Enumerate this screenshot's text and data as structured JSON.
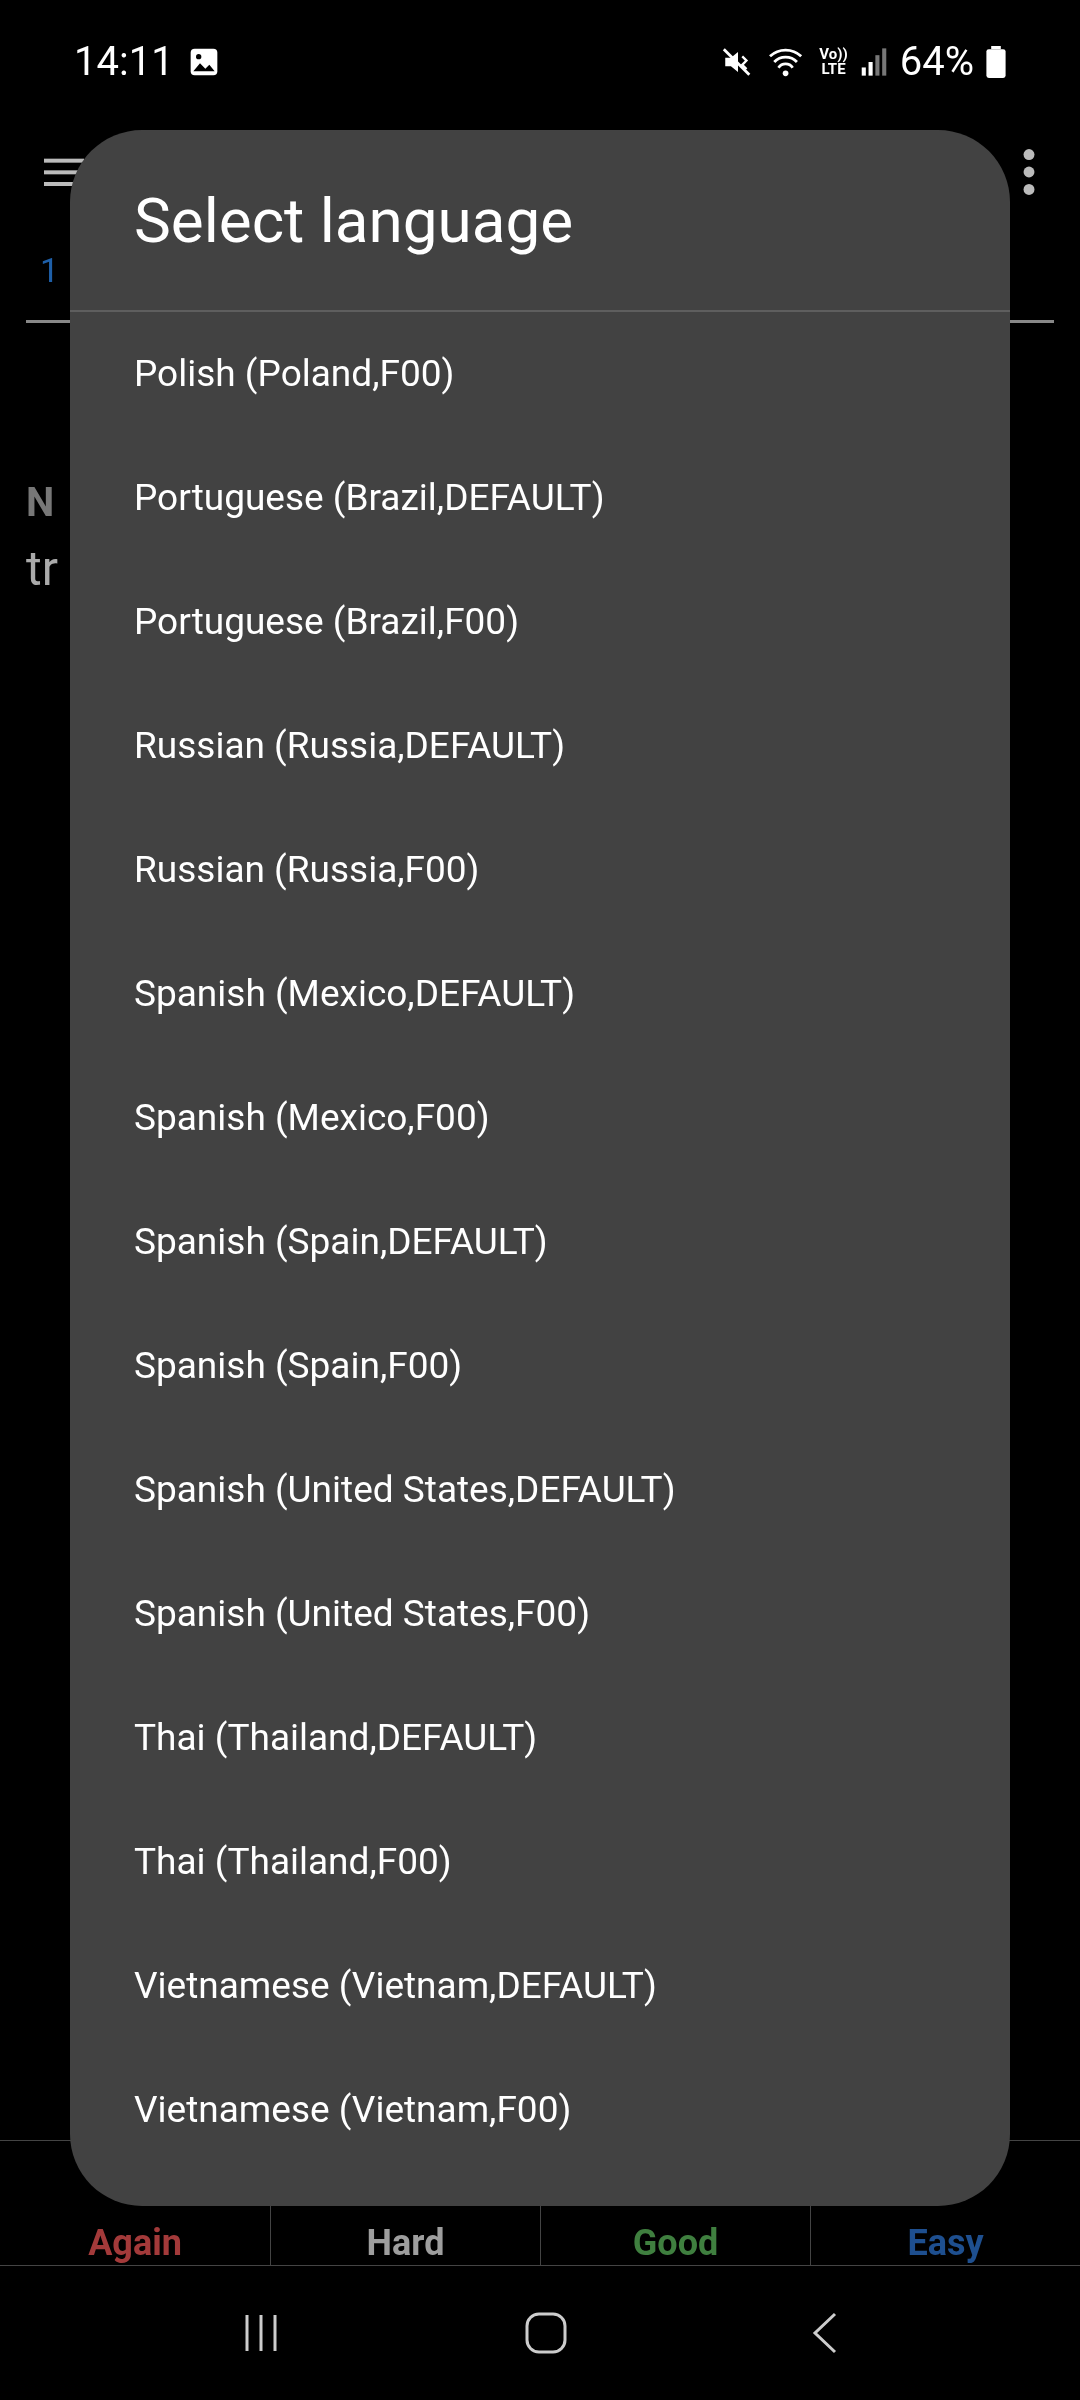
{
  "status_bar": {
    "time": "14:11",
    "battery": "64%",
    "volte": "Vo))",
    "lte": "LTE"
  },
  "background": {
    "counter": "1",
    "heading": "N",
    "text": "tr"
  },
  "answer_buttons": [
    {
      "label": "Again",
      "color": "#a33a3a"
    },
    {
      "label": "Hard",
      "color": "#9e9e9e"
    },
    {
      "label": "Good",
      "color": "#3f7f3f"
    },
    {
      "label": "Easy",
      "color": "#1e4f8f"
    }
  ],
  "dialog": {
    "title": "Select language",
    "items": [
      "Polish (Poland,F00)",
      "Portuguese (Brazil,DEFAULT)",
      "Portuguese (Brazil,F00)",
      "Russian (Russia,DEFAULT)",
      "Russian (Russia,F00)",
      "Spanish (Mexico,DEFAULT)",
      "Spanish (Mexico,F00)",
      "Spanish (Spain,DEFAULT)",
      "Spanish (Spain,F00)",
      "Spanish (United States,DEFAULT)",
      "Spanish (United States,F00)",
      "Thai (Thailand,DEFAULT)",
      "Thai (Thailand,F00)",
      "Vietnamese (Vietnam,DEFAULT)",
      "Vietnamese (Vietnam,F00)"
    ]
  }
}
